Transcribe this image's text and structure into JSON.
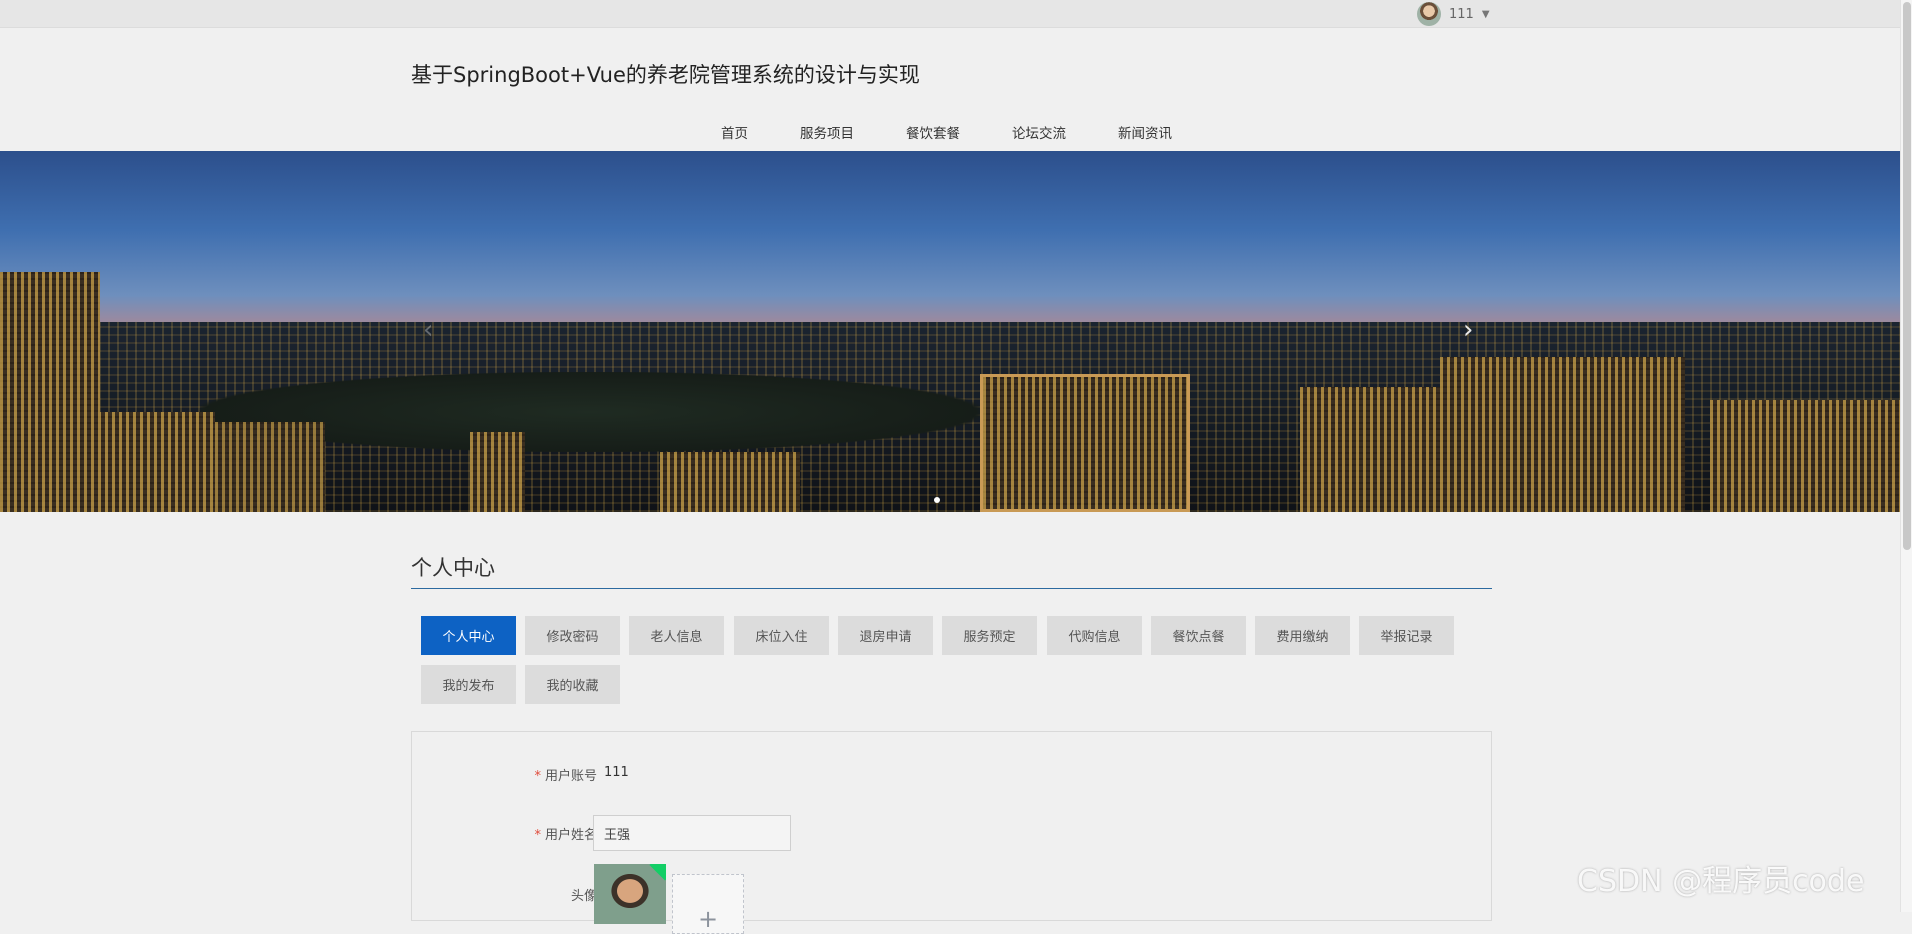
{
  "topbar": {
    "username": "111"
  },
  "header": {
    "title": "基于SpringBoot+Vue的养老院管理系统的设计与实现",
    "nav": [
      "首页",
      "服务项目",
      "餐饮套餐",
      "论坛交流",
      "新闻资讯"
    ]
  },
  "banner": {
    "prev_icon": "chevron-left-icon",
    "next_icon": "chevron-right-icon",
    "active_slide": 1,
    "slide_count": 1
  },
  "personal_center": {
    "title": "个人中心",
    "tabs": [
      "个人中心",
      "修改密码",
      "老人信息",
      "床位入住",
      "退房申请",
      "服务预定",
      "代购信息",
      "餐饮点餐",
      "费用缴纳",
      "举报记录",
      "我的发布",
      "我的收藏"
    ],
    "active_tab": "个人中心"
  },
  "form": {
    "account_label": "用户账号",
    "account_value": "111",
    "name_label": "用户姓名",
    "name_value": "王强",
    "avatar_label": "头像",
    "upload_icon": "plus-icon"
  },
  "watermark": "CSDN @程序员code",
  "colors": {
    "accent": "#0d62c4",
    "divider": "#2c6aa0",
    "tab_bg": "#dcdcdc",
    "required": "#e04a3a"
  }
}
